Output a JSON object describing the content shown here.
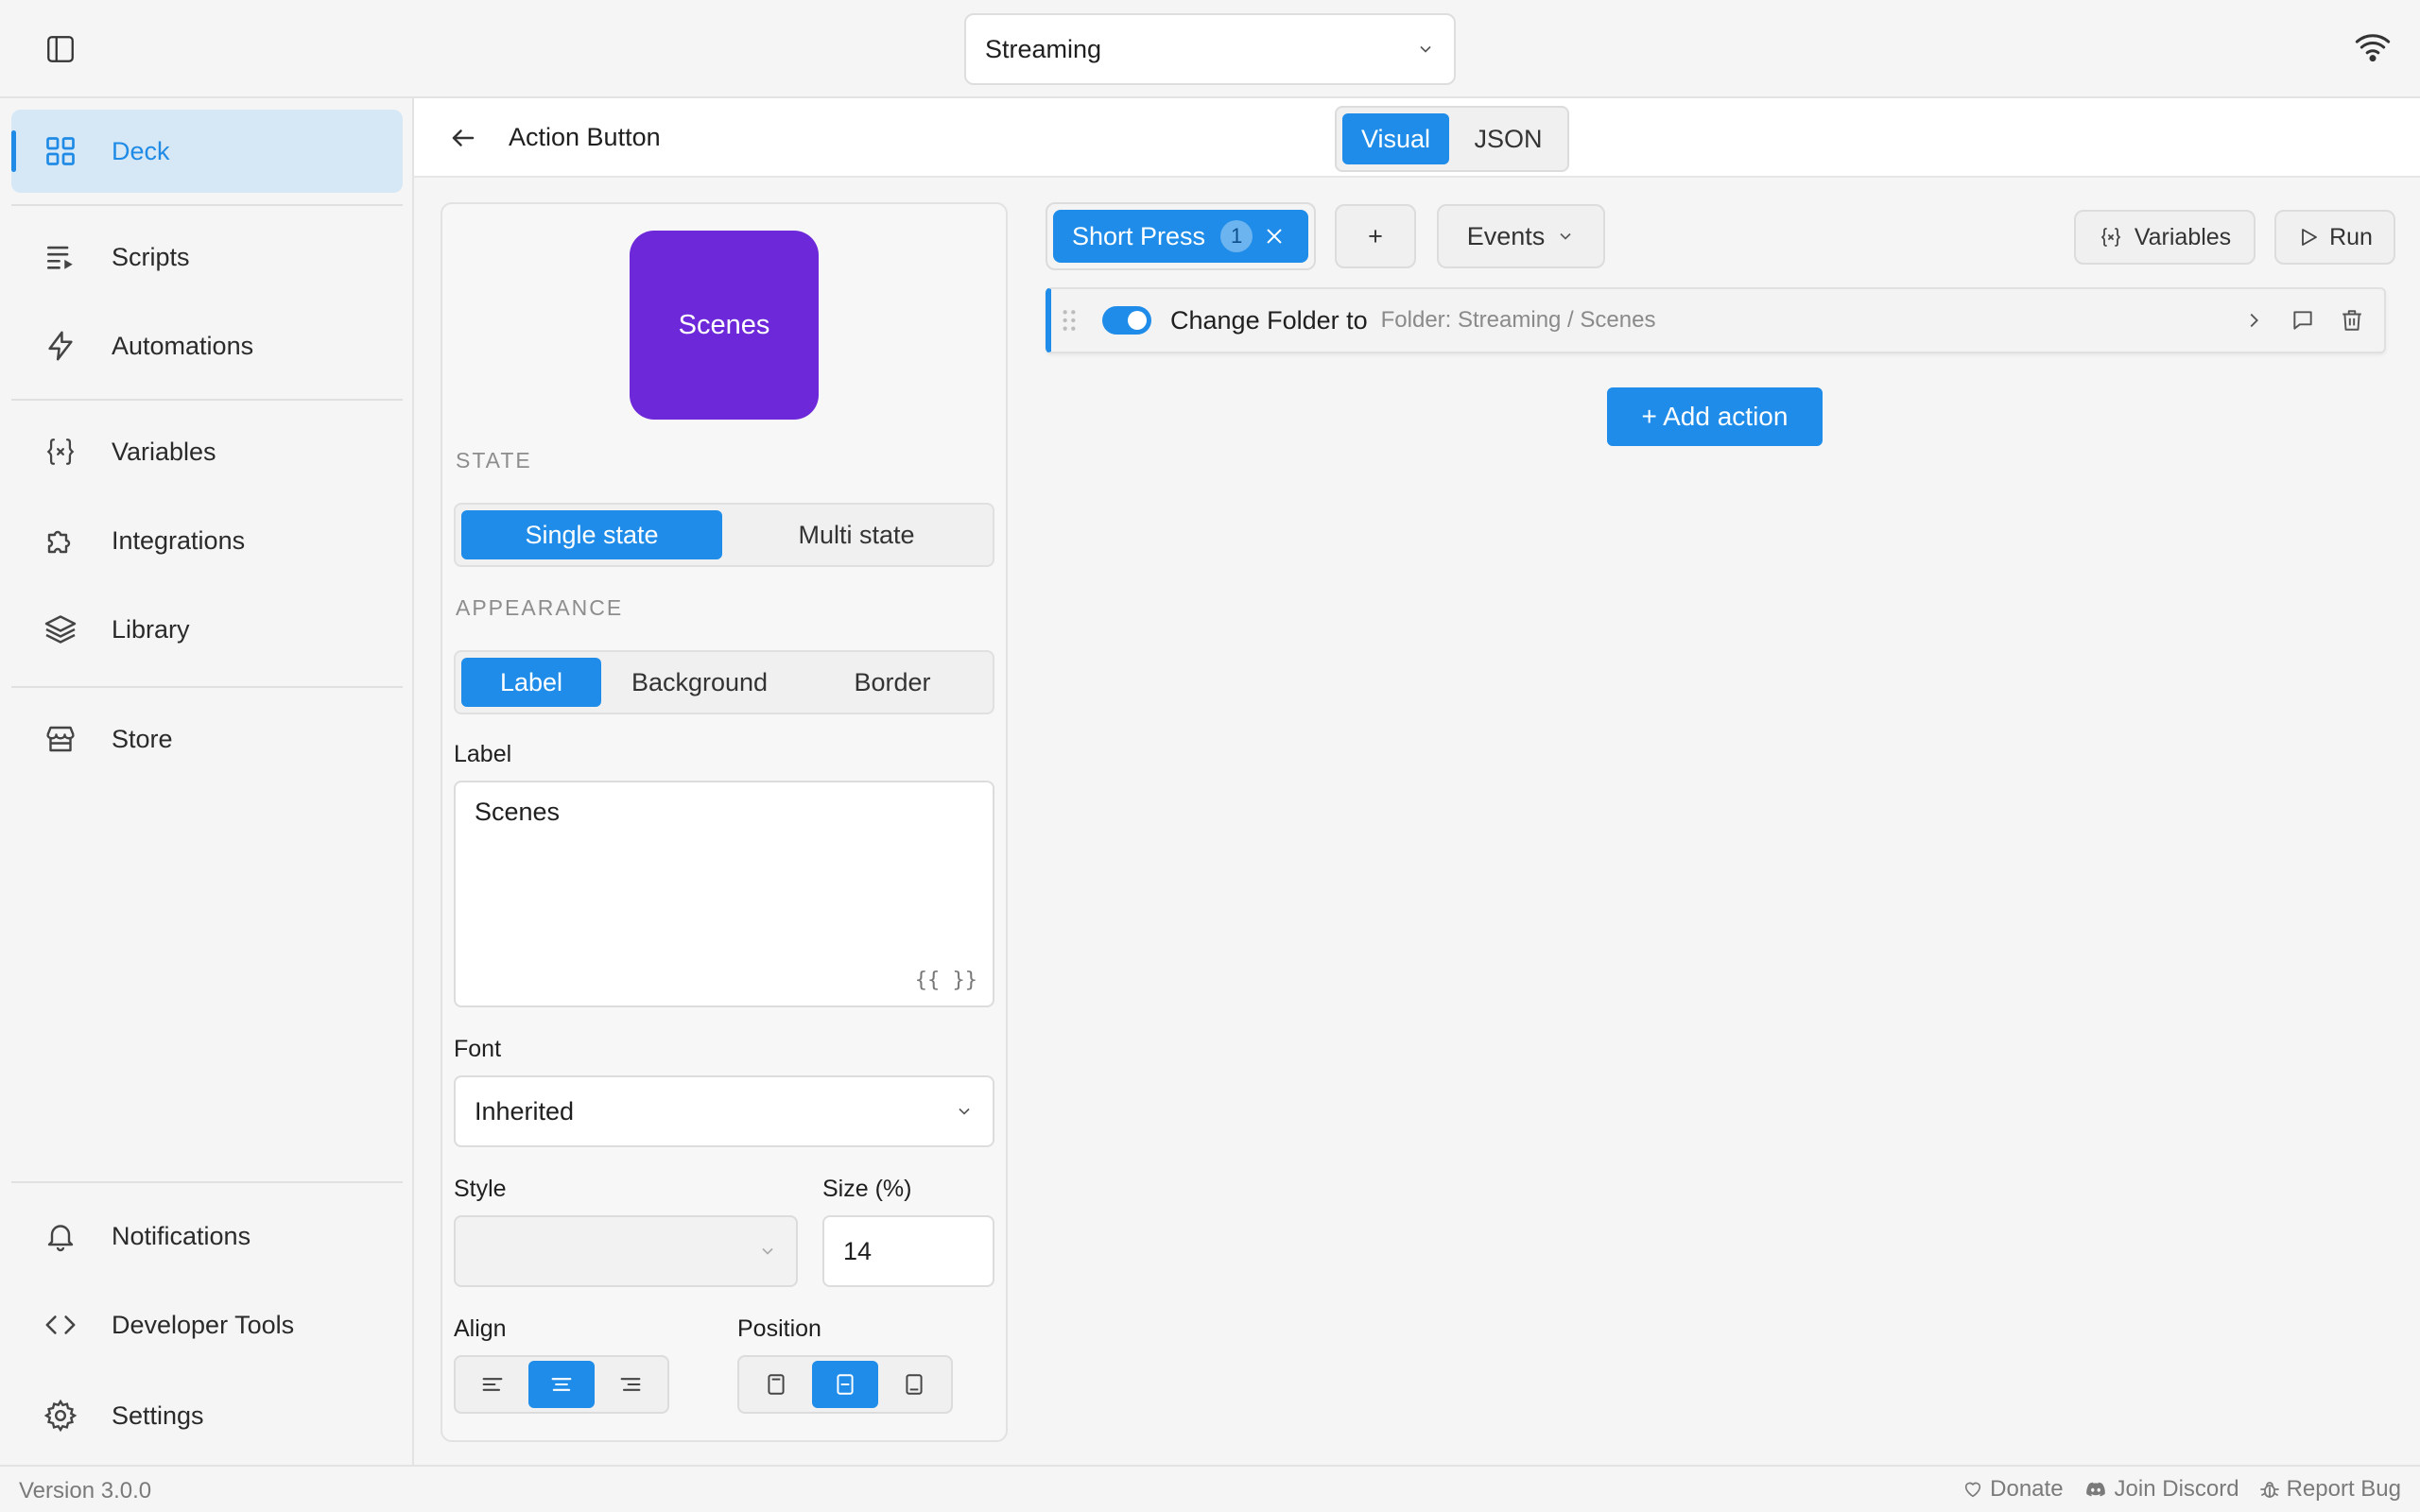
{
  "topbar": {
    "deck_name": "Streaming"
  },
  "sidebar": {
    "items": [
      {
        "label": "Deck",
        "icon": "grid-icon"
      },
      {
        "label": "Scripts",
        "icon": "script-list-icon"
      },
      {
        "label": "Automations",
        "icon": "lightning-icon"
      },
      {
        "label": "Variables",
        "icon": "variable-braces-icon"
      },
      {
        "label": "Integrations",
        "icon": "puzzle-icon"
      },
      {
        "label": "Library",
        "icon": "layers-icon"
      },
      {
        "label": "Store",
        "icon": "store-icon"
      },
      {
        "label": "Notifications",
        "icon": "bell-icon"
      },
      {
        "label": "Developer Tools",
        "icon": "code-icon"
      },
      {
        "label": "Settings",
        "icon": "gear-icon"
      }
    ]
  },
  "header": {
    "title": "Action Button",
    "view_options": [
      "Visual",
      "JSON"
    ],
    "selected_view": "Visual"
  },
  "panel": {
    "preview_label": "Scenes",
    "preview_color": "#6d28d9",
    "state_heading": "STATE",
    "state_options": [
      "Single state",
      "Multi state"
    ],
    "appearance_heading": "APPEARANCE",
    "appearance_tabs": [
      "Label",
      "Background",
      "Border"
    ],
    "label_field": {
      "label": "Label",
      "value": "Scenes",
      "template_hint": "{{ }}"
    },
    "font_field": {
      "label": "Font",
      "value": "Inherited"
    },
    "style_field": {
      "label": "Style",
      "value": ""
    },
    "size_field": {
      "label": "Size (%)",
      "value": "14"
    },
    "align_label": "Align",
    "position_label": "Position"
  },
  "triggers": {
    "active_label": "Short Press",
    "active_count": "1",
    "add_symbol": "+",
    "events_label": "Events",
    "variables_label": "Variables",
    "run_label": "Run"
  },
  "actions": [
    {
      "name": "Change Folder to",
      "detail": "Folder: Streaming / Scenes",
      "enabled": true
    }
  ],
  "add_action_label": "+ Add action",
  "footer": {
    "version": "Version 3.0.0",
    "donate": "Donate",
    "discord": "Join Discord",
    "bug": "Report Bug"
  },
  "colors": {
    "accent": "#1e8ce8",
    "sidebar_active_bg": "#d6e7f5"
  }
}
